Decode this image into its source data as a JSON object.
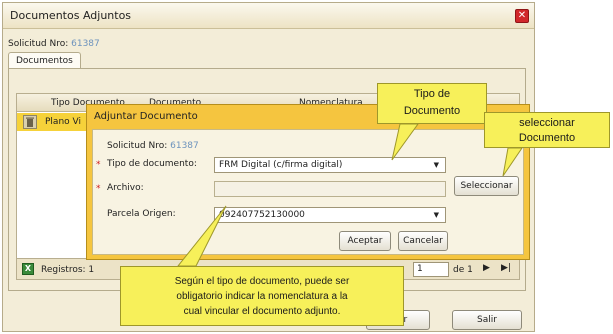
{
  "window": {
    "title": "Documentos Adjuntos",
    "solicitud_label": "Solicitud Nro:",
    "solicitud_number": "61387",
    "tab_label": "Documentos",
    "close_icon": "close-icon"
  },
  "grid": {
    "headers": [
      "Tipo Documento",
      "Documento",
      "Nomenclatura"
    ],
    "row": {
      "tipo": "Plano Vi"
    },
    "registros": "Registros: 1",
    "page_prefix": "Pág",
    "page_value": "1",
    "page_of": "de 1"
  },
  "buttons": {
    "adjuntar_partial": "ntar",
    "salir": "Salir"
  },
  "dialog": {
    "title": "Adjuntar Documento",
    "solicitud_label": "Solicitud Nro:",
    "solicitud_number": "61387",
    "tipo_label": "Tipo de documento:",
    "tipo_value": "FRM Digital (c/firma digital)",
    "archivo_label": "Archivo:",
    "seleccionar_label": "Seleccionar",
    "parcela_label": "Parcela Origen:",
    "parcela_value": "092407752130000",
    "aceptar_label": "Aceptar",
    "cancelar_label": "Cancelar"
  },
  "callouts": {
    "tipo_line1": "Tipo de",
    "tipo_line2": "Documento",
    "select_line1": "seleccionar",
    "select_line2": "Documento",
    "info_line1": "Según el tipo de documento, puede ser",
    "info_line2": "obligatorio indicar la nomenclatura a la",
    "info_line3": "cual vincular el documento adjunto."
  },
  "colors": {
    "dialog_header": "#f5c53f",
    "selected_row": "#f6d23a",
    "callout": "#f7f05a",
    "close_button": "#d1272a",
    "link_number": "#6d93bd"
  }
}
